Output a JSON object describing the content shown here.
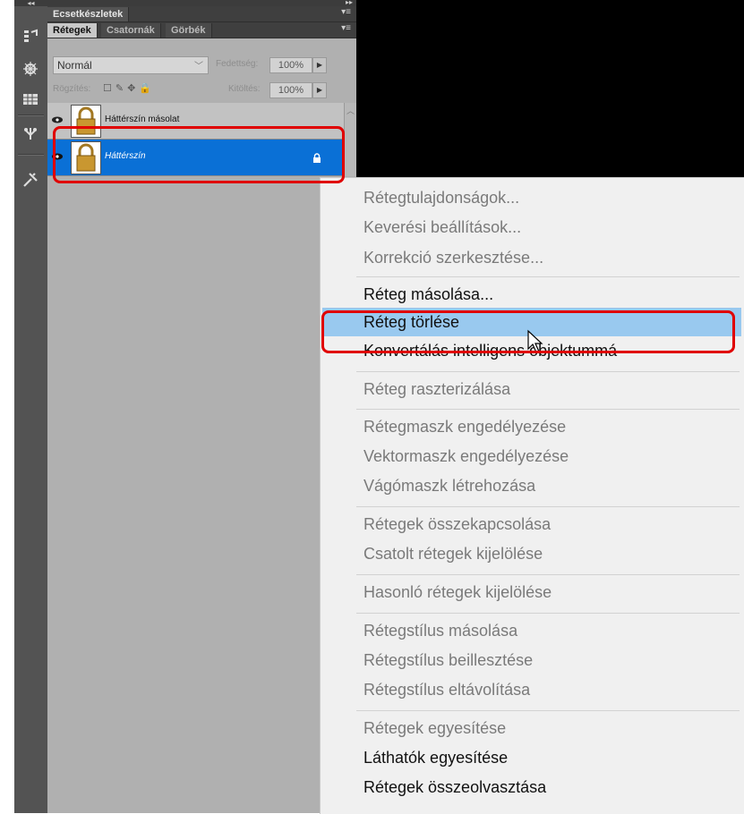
{
  "toolstrip": {
    "collapse_glyph": "◂◂",
    "tools": [
      {
        "icon": "brush-presets-icon"
      },
      {
        "icon": "navigator-icon"
      },
      {
        "icon": "swatches-icon"
      },
      {
        "icon": "clone-source-icon"
      },
      {
        "icon": "tool-presets-icon"
      }
    ]
  },
  "panel": {
    "top_tab": "Ecsetkészletek",
    "tabs": [
      "Rétegek",
      "Csatornák",
      "Görbék"
    ],
    "active_tab": "Rétegek",
    "blend_mode": "Normál",
    "opacity_label": "Fedettség:",
    "opacity_value": "100%",
    "lock_label": "Rögzítés:",
    "fill_label": "Kitöltés:",
    "fill_value": "100%",
    "layers": [
      {
        "name": "Háttérszín másolat",
        "selected": false
      },
      {
        "name": "Háttérszín",
        "selected": true
      }
    ]
  },
  "context_menu": {
    "groups": [
      [
        {
          "label": "Rétegtulajdonságok...",
          "enabled": false
        },
        {
          "label": "Keverési beállítások...",
          "enabled": false
        },
        {
          "label": "Korrekció szerkesztése...",
          "enabled": false
        }
      ],
      [
        {
          "label": "Réteg másolása...",
          "enabled": true
        },
        {
          "label": "Réteg törlése",
          "enabled": true,
          "highlighted": true
        },
        {
          "label": "Konvertálás intelligens objektummá",
          "enabled": true
        }
      ],
      [
        {
          "label": "Réteg raszterizálása",
          "enabled": false
        }
      ],
      [
        {
          "label": "Rétegmaszk engedélyezése",
          "enabled": false
        },
        {
          "label": "Vektormaszk engedélyezése",
          "enabled": false
        },
        {
          "label": "Vágómaszk létrehozása",
          "enabled": false
        }
      ],
      [
        {
          "label": "Rétegek összekapcsolása",
          "enabled": false
        },
        {
          "label": "Csatolt rétegek kijelölése",
          "enabled": false
        }
      ],
      [
        {
          "label": "Hasonló rétegek kijelölése",
          "enabled": false
        }
      ],
      [
        {
          "label": "Rétegstílus másolása",
          "enabled": false
        },
        {
          "label": "Rétegstílus beillesztése",
          "enabled": false
        },
        {
          "label": "Rétegstílus eltávolítása",
          "enabled": false
        }
      ],
      [
        {
          "label": "Rétegek egyesítése",
          "enabled": false
        },
        {
          "label": "Láthatók egyesítése",
          "enabled": true
        },
        {
          "label": "Rétegek összeolvasztása",
          "enabled": true
        }
      ]
    ]
  },
  "colors": {
    "selected_layer": "#0a70d6",
    "menu_highlight": "#99c9ef",
    "annotation_red": "#e00000"
  }
}
